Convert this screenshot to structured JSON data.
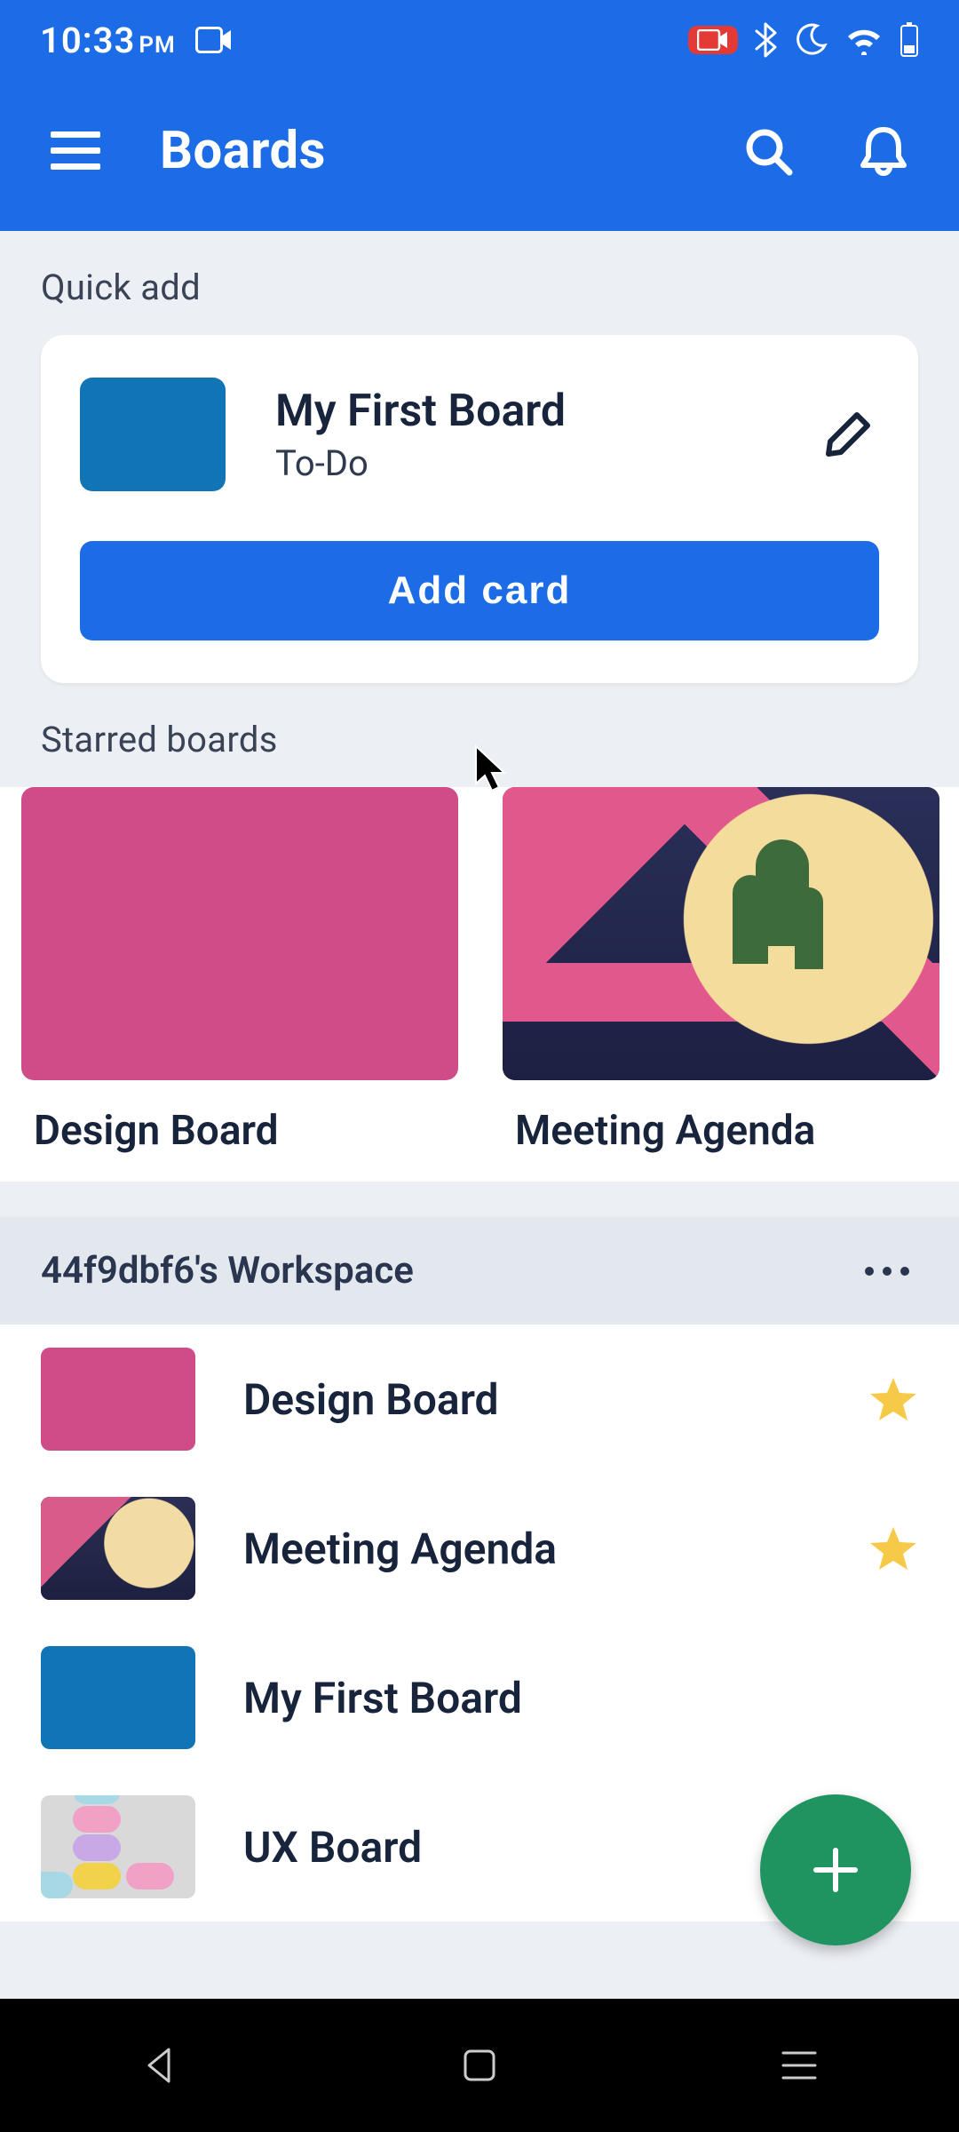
{
  "status": {
    "time": "10:33",
    "ampm": "PM"
  },
  "header": {
    "title": "Boards"
  },
  "quick_add": {
    "section_label": "Quick add",
    "board_name": "My First Board",
    "list_name": "To-Do",
    "add_button": "Add card",
    "thumb_color": "#1175b5"
  },
  "starred": {
    "section_label": "Starred boards",
    "items": [
      {
        "name": "Design Board",
        "color": "#cf4c89"
      },
      {
        "name": "Meeting Agenda",
        "illustration": true
      }
    ]
  },
  "workspace": {
    "title": "44f9dbf6's Workspace",
    "boards": [
      {
        "name": "Design Board",
        "starred": true,
        "color": "#cf4c89"
      },
      {
        "name": "Meeting Agenda",
        "starred": true,
        "illustration": true
      },
      {
        "name": "My First Board",
        "starred": false,
        "color": "#1175b5"
      },
      {
        "name": "UX Board",
        "starred": false,
        "macaron": true
      }
    ]
  },
  "colors": {
    "brand": "#1b6ce6",
    "fab": "#1f9360",
    "pink": "#cf4c89",
    "blue_thumb": "#1175b5",
    "star": "#f7c948"
  }
}
